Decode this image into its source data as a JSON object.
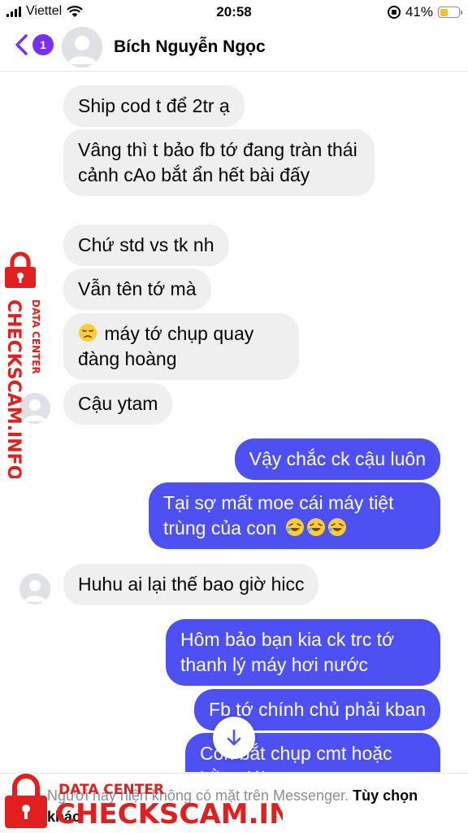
{
  "status_bar": {
    "carrier": "Viettel",
    "time": "20:58",
    "battery": "41%",
    "battery_level": 0.41
  },
  "header": {
    "unread_count": "1",
    "contact_name": "Bích Nguyễn Ngọc"
  },
  "messages": [
    {
      "direction": "in",
      "text": "Ship cod t để 2tr ạ"
    },
    {
      "direction": "in",
      "text": "Vâng thì t bảo fb tớ đang tràn thái cảnh cAo bắt ẩn hết bài đấy"
    },
    {
      "direction": "in",
      "text": "Chứ std vs tk nh"
    },
    {
      "direction": "in",
      "text": "Vẫn tên tớ mà"
    },
    {
      "direction": "in",
      "emoji": "disappointed-face",
      "text": "máy tớ chụp quay đàng hoàng"
    },
    {
      "direction": "in",
      "text": "Cậu ytam"
    },
    {
      "direction": "out",
      "text": "Vậy chắc ck cậu luôn"
    },
    {
      "direction": "out",
      "text": "Tại sợ mất moe cái máy tiệt trùng của con",
      "emoji_suffix": "rofl-face ×3"
    },
    {
      "direction": "in",
      "text": "Huhu ai lại thế bao giờ hicc"
    },
    {
      "direction": "out",
      "text": "Hôm bảo bạn kia ck trc tớ thanh lý máy hơi nước"
    },
    {
      "direction": "out",
      "text": "Fb tớ chính chủ phải kban"
    },
    {
      "direction": "out",
      "text": "Còn bắt chụp cmt hoặc bằng lái"
    }
  ],
  "notice": {
    "text": "Người này hiện không có mặt trên Messenger.",
    "link": "Tùy chọn khác"
  },
  "watermark": {
    "title": "DATA CENTER",
    "brand": "CHECKSCAM.INFO",
    "color": "#e21f1f"
  },
  "colors": {
    "outgoing_bubble": "#4d50f2",
    "incoming_bubble": "#efefef",
    "accent": "#7a2ff7"
  }
}
